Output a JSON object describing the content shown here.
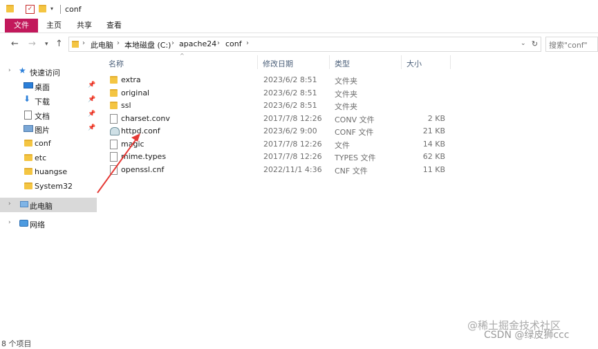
{
  "window": {
    "title": "conf"
  },
  "ribbon": {
    "tabs": [
      "文件",
      "主页",
      "共享",
      "查看"
    ]
  },
  "address": {
    "crumbs": [
      "此电脑",
      "本地磁盘 (C:)",
      "apache24",
      "conf"
    ],
    "search_placeholder": "搜索\"conf\""
  },
  "sidebar": {
    "quick_access": "快速访问",
    "items": [
      {
        "label": "桌面",
        "icon": "desktop-icon",
        "pinned": true
      },
      {
        "label": "下载",
        "icon": "download-icon",
        "pinned": true
      },
      {
        "label": "文档",
        "icon": "document-icon",
        "pinned": true
      },
      {
        "label": "图片",
        "icon": "picture-icon",
        "pinned": true
      },
      {
        "label": "conf",
        "icon": "folder-icon",
        "pinned": false
      },
      {
        "label": "etc",
        "icon": "folder-icon",
        "pinned": false
      },
      {
        "label": "huangse",
        "icon": "folder-icon",
        "pinned": false
      },
      {
        "label": "System32",
        "icon": "folder-icon",
        "pinned": false
      }
    ],
    "this_pc": "此电脑",
    "network": "网络"
  },
  "columns": {
    "name": "名称",
    "modified": "修改日期",
    "type": "类型",
    "size": "大小"
  },
  "files": [
    {
      "name": "extra",
      "date": "2023/6/2 8:51",
      "type": "文件夹",
      "size": "",
      "icon": "folder-icon"
    },
    {
      "name": "original",
      "date": "2023/6/2 8:51",
      "type": "文件夹",
      "size": "",
      "icon": "folder-icon"
    },
    {
      "name": "ssl",
      "date": "2023/6/2 8:51",
      "type": "文件夹",
      "size": "",
      "icon": "folder-icon"
    },
    {
      "name": "charset.conv",
      "date": "2017/7/8 12:26",
      "type": "CONV 文件",
      "size": "2 KB",
      "icon": "file-icon"
    },
    {
      "name": "httpd.conf",
      "date": "2023/6/2 9:00",
      "type": "CONF 文件",
      "size": "21 KB",
      "icon": "conf-file-icon"
    },
    {
      "name": "magic",
      "date": "2017/7/8 12:26",
      "type": "文件",
      "size": "14 KB",
      "icon": "file-icon"
    },
    {
      "name": "mime.types",
      "date": "2017/7/8 12:26",
      "type": "TYPES 文件",
      "size": "62 KB",
      "icon": "file-icon"
    },
    {
      "name": "openssl.cnf",
      "date": "2022/11/1 4:36",
      "type": "CNF 文件",
      "size": "11 KB",
      "icon": "file-icon"
    }
  ],
  "status": {
    "count": "8 个项目"
  },
  "watermark": {
    "line1": "@稀土掘金技术社区",
    "line2": "CSDN @绿皮狮ccc"
  },
  "colors": {
    "file_tab": "#c2185b",
    "arrow": "#e53935",
    "selected": "#d9d9d9"
  }
}
